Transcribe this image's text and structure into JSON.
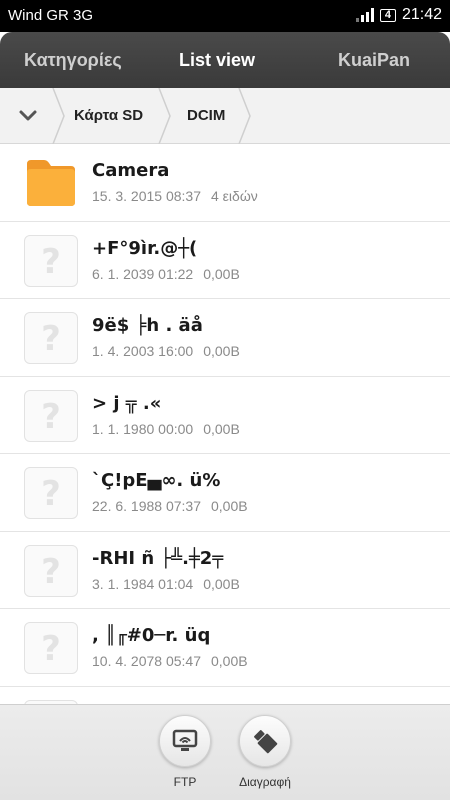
{
  "status_bar": {
    "carrier": "Wind GR 3G",
    "battery": "4",
    "time": "21:42"
  },
  "tabs": [
    {
      "label": "Κατηγορίες",
      "active": false
    },
    {
      "label": "List view",
      "active": true
    },
    {
      "label": "KuaiPan",
      "active": false
    }
  ],
  "breadcrumb": {
    "items": [
      "Κάρτα SD",
      "DCIM"
    ]
  },
  "files": [
    {
      "name": "Camera",
      "date": "15. 3. 2015 08:37",
      "info": "4 ειδών",
      "icon": "folder-icon"
    },
    {
      "name": "  +F°9ìr.@┼(",
      "date": "6. 1. 2039 01:22",
      "info": "0,00B",
      "icon": "unknown-file-icon"
    },
    {
      "name": " 9ë$ ╞h . äå",
      "date": "1. 4. 2003 16:00",
      "info": "0,00B",
      "icon": "unknown-file-icon"
    },
    {
      "name": "  > j ╦ .«",
      "date": "1. 1. 1980 00:00",
      "info": "0,00B",
      "icon": "unknown-file-icon"
    },
    {
      "name": " `Ç!pE▄∞. ü%",
      "date": "22. 6. 1988 07:37",
      "info": "0,00B",
      "icon": "unknown-file-icon"
    },
    {
      "name": "-RHI ñ ├╩.╪2╤",
      "date": "3. 1. 1984 01:04",
      "info": "0,00B",
      "icon": "unknown-file-icon"
    },
    {
      "name": ", ║╓#0─r. üq",
      "date": "10. 4. 2078 05:47",
      "info": "0,00B",
      "icon": "unknown-file-icon"
    }
  ],
  "actions": [
    {
      "label": "FTP",
      "icon": "ftp-icon"
    },
    {
      "label": "Διαγραφή",
      "icon": "delete-icon"
    }
  ],
  "colors": {
    "folder": "#f6a623",
    "tab_bar": "#404040",
    "status_bar": "#000000"
  }
}
